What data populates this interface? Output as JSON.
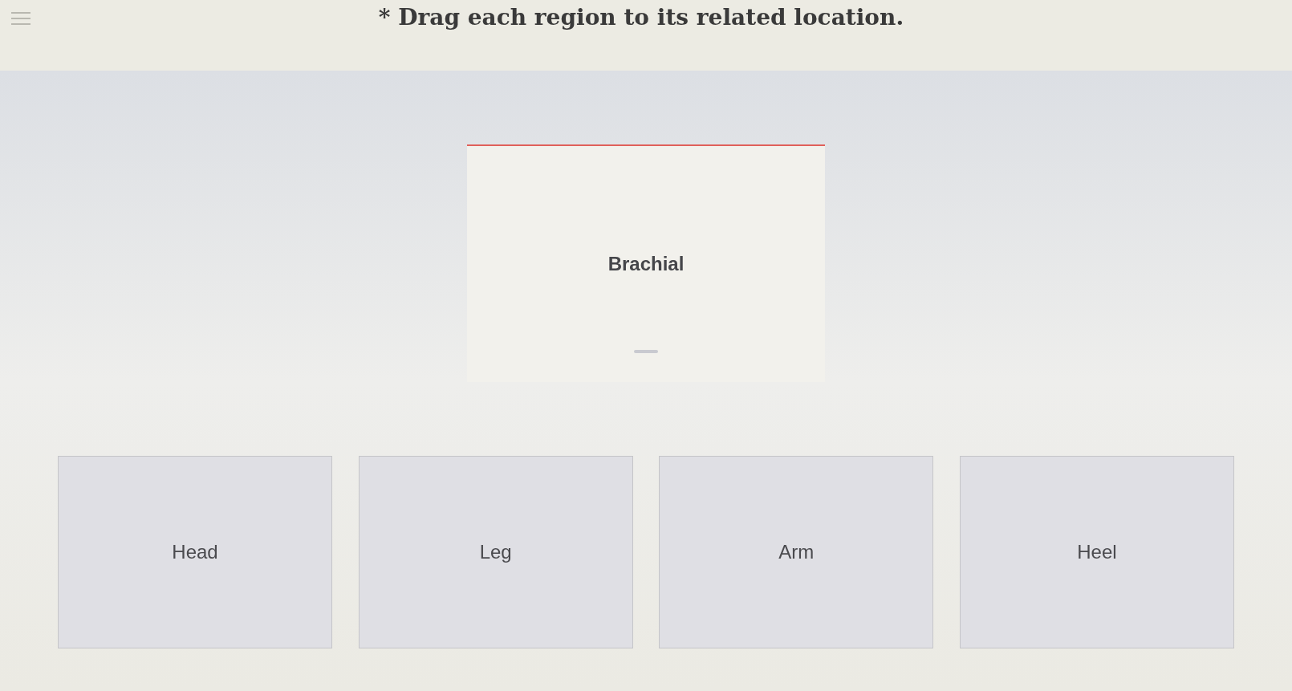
{
  "header": {
    "title": "* Drag each region to its related location."
  },
  "draggable": {
    "label": "Brachial"
  },
  "targets": [
    {
      "label": "Head"
    },
    {
      "label": "Leg"
    },
    {
      "label": "Arm"
    },
    {
      "label": "Heel"
    }
  ]
}
